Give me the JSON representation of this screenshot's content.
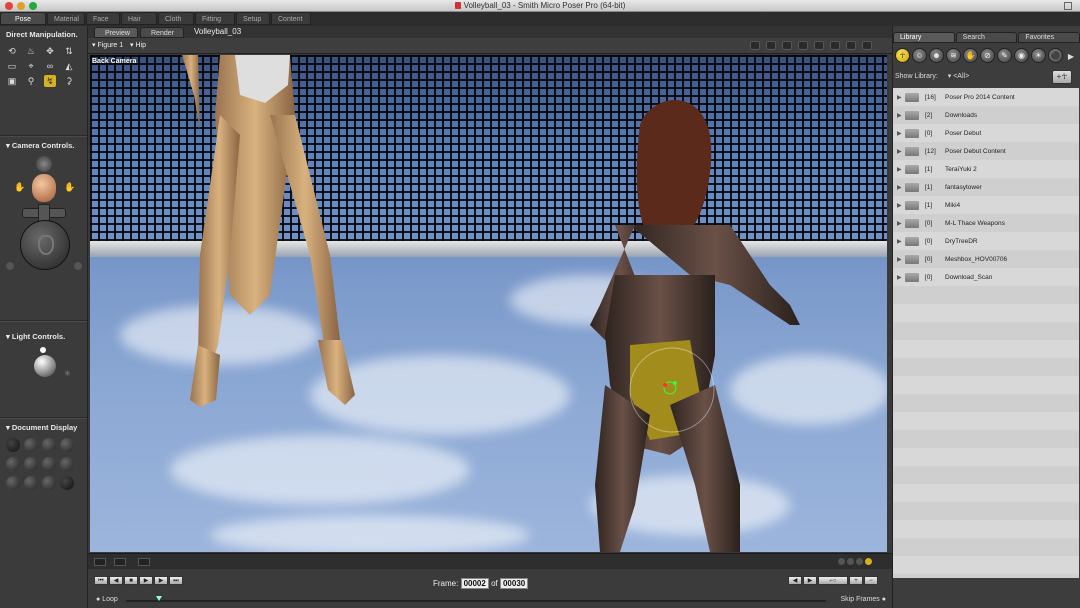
{
  "window": {
    "title": "Volleyball_03 - Smith Micro Poser Pro  (64-bit)"
  },
  "room_tabs": [
    "Pose",
    "Material",
    "Face",
    "Hair",
    "Cloth",
    "Fitting",
    "Setup",
    "Content"
  ],
  "left_panel": {
    "direct_manipulation": "Direct Manipulation.",
    "camera_controls": "Camera Controls.",
    "light_controls": "Light Controls.",
    "document_display": "Document Display"
  },
  "document": {
    "tabs": [
      "Preview",
      "Render"
    ],
    "name": "Volleyball_03",
    "figure_select": "Figure 1",
    "part_select": "Hip",
    "camera": "Back Camera"
  },
  "animation": {
    "frame_label": "Frame:",
    "current_frame": "00002",
    "of_label": "of",
    "total_frames": "00030",
    "loop_label": "Loop",
    "skip_frames_label": "Skip Frames"
  },
  "library": {
    "tabs": [
      "Library",
      "Search",
      "Favorites"
    ],
    "show_library_label": "Show Library:",
    "show_library_value": "<All>",
    "items": [
      {
        "count": "[16]",
        "name": "Poser Pro 2014 Content"
      },
      {
        "count": "[2]",
        "name": "Downloads"
      },
      {
        "count": "[0]",
        "name": "Poser Debut"
      },
      {
        "count": "[12]",
        "name": "Poser Debut Content"
      },
      {
        "count": "[1]",
        "name": "TeraiYuki 2"
      },
      {
        "count": "[1]",
        "name": "fantasytower"
      },
      {
        "count": "[1]",
        "name": "Miki4"
      },
      {
        "count": "[0]",
        "name": "M-L Thace Weapons"
      },
      {
        "count": "[0]",
        "name": "DryTreeDR"
      },
      {
        "count": "[0]",
        "name": "Meshbox_HOV00706"
      },
      {
        "count": "[0]",
        "name": "Download_Scan"
      }
    ]
  },
  "colors": {
    "accent": "#d6b21e",
    "panel": "#3b3b3b"
  }
}
